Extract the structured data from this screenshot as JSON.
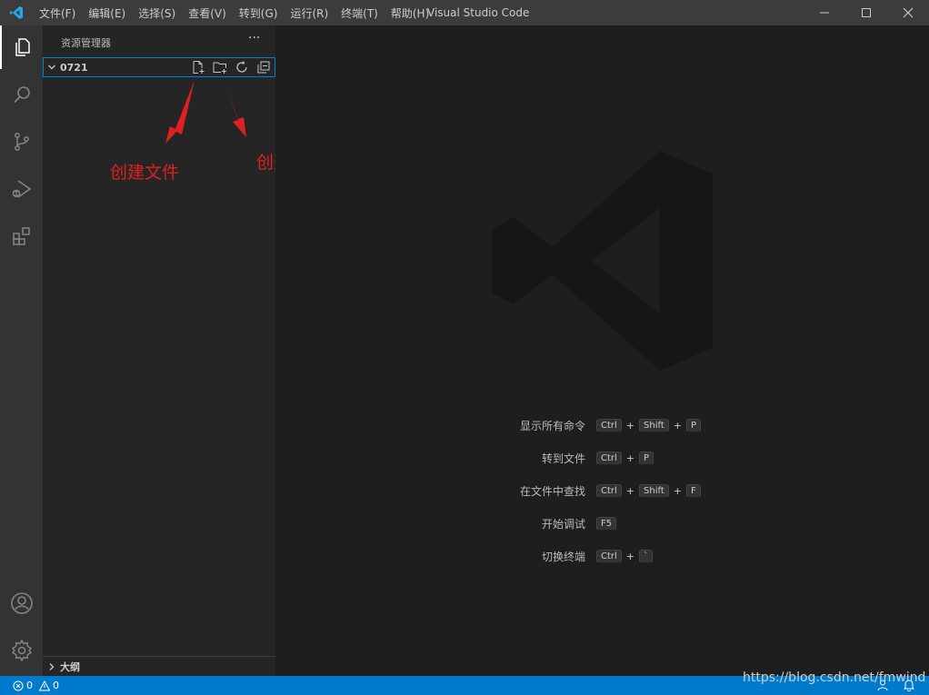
{
  "title_bar": {
    "app_title": "Visual Studio Code",
    "menu": [
      "文件(F)",
      "编辑(E)",
      "选择(S)",
      "查看(V)",
      "转到(G)",
      "运行(R)",
      "终端(T)",
      "帮助(H)"
    ],
    "logo_icon": "vscode-logo-icon",
    "window_controls": [
      "minimize-icon",
      "maximize-icon",
      "close-icon"
    ]
  },
  "activity_bar": {
    "top": [
      "explorer-icon",
      "search-icon",
      "source-control-icon",
      "run-debug-icon",
      "extensions-icon"
    ],
    "bottom": [
      "account-icon",
      "settings-gear-icon"
    ]
  },
  "sidebar": {
    "header": "资源管理器",
    "more": "···",
    "folder": "0721",
    "folder_actions": [
      "new-file-icon",
      "new-folder-icon",
      "refresh-icon",
      "collapse-all-icon"
    ],
    "outline": "大纲"
  },
  "annotations": {
    "create_file": "创建文件",
    "create_folder": "创建文件夹",
    "color": "#e02020"
  },
  "shortcuts": [
    {
      "label": "显示所有命令",
      "keys": [
        "Ctrl",
        "Shift",
        "P"
      ]
    },
    {
      "label": "转到文件",
      "keys": [
        "Ctrl",
        "P"
      ]
    },
    {
      "label": "在文件中查找",
      "keys": [
        "Ctrl",
        "Shift",
        "F"
      ]
    },
    {
      "label": "开始调试",
      "keys": [
        "F5"
      ]
    },
    {
      "label": "切换终端",
      "keys": [
        "Ctrl",
        "`"
      ]
    }
  ],
  "status_bar": {
    "errors": "0",
    "warnings": "0",
    "color": "#007acc"
  },
  "watermark": "https://blog.csdn.net/fmwind"
}
